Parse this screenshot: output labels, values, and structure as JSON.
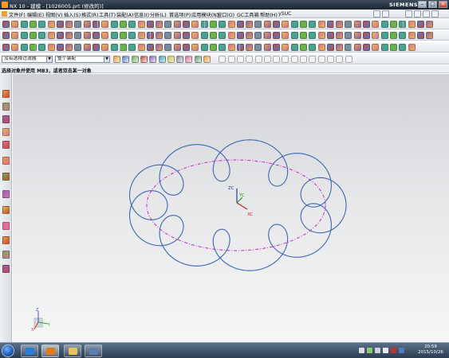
{
  "window": {
    "title": "NX 10 - 建模 - [1026005.prt (修改的)]",
    "brand": "SIEMENS",
    "controls": [
      "–",
      "□",
      "×"
    ]
  },
  "menu": {
    "items": [
      "文件(F)",
      "编辑(E)",
      "视图(V)",
      "插入(S)",
      "格式(R)",
      "工具(T)",
      "装配(A)",
      "信息(I)",
      "分析(L)",
      "首选项(P)",
      "应用模块(N)",
      "窗口(O)",
      "GC工具箱",
      "帮助(H)",
      "ySUC"
    ]
  },
  "filterbar": {
    "type_filter": "没有选择过滤器",
    "scope": "整个装配"
  },
  "cue": {
    "text": "选择对象并使用 MB3，或者双击某一对象"
  },
  "graphics": {
    "wcs_labels": {
      "zc": "ZC",
      "yc": "YC",
      "xc": "XC"
    },
    "triad_labels": {
      "z": "Z",
      "y": "Y",
      "x": "X"
    },
    "curve_colors": {
      "spline": "#3b67b8",
      "ellipse": "#d11fd0"
    }
  },
  "taskbar": {
    "clock": {
      "time": "20:59",
      "date": "2015/10/26"
    }
  }
}
